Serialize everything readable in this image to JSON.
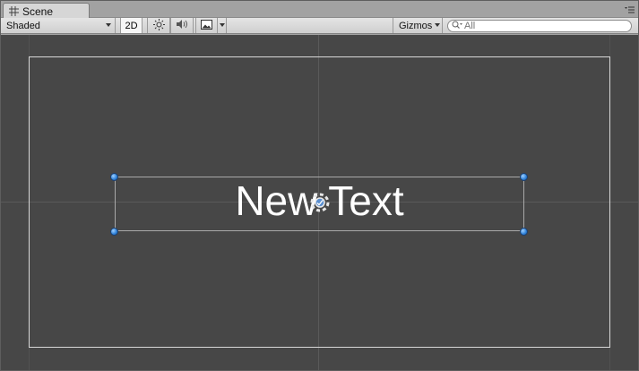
{
  "tab": {
    "label": "Scene"
  },
  "toolbar": {
    "shading_mode": "Shaded",
    "mode_2d": "2D",
    "gizmos_label": "Gizmos",
    "search_placeholder": "All",
    "icons": [
      "lighting-icon",
      "audio-icon",
      "effects-icon",
      "search-icon"
    ]
  },
  "scene": {
    "text_object": "New Text"
  },
  "colors": {
    "viewport_bg": "#474747",
    "handle": "#2b7fd8",
    "text": "#ffffff"
  }
}
